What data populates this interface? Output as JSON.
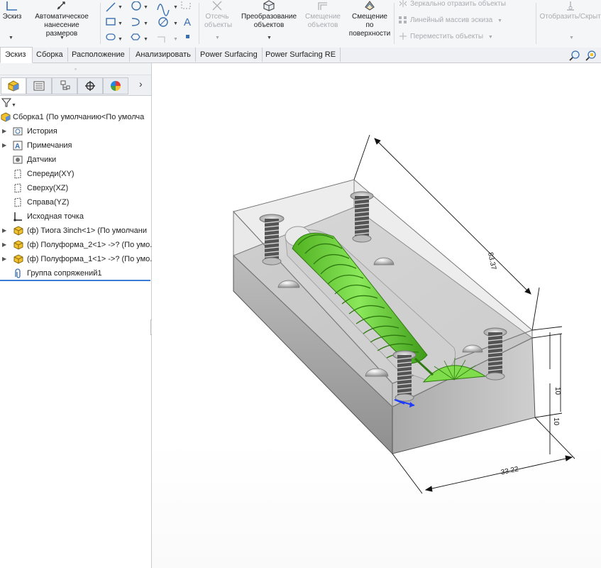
{
  "toolbar": {
    "sketch_label": "Эскиз",
    "smart_dim_label": "Автоматическое нанесение размеров",
    "trim_label": "Отсечь объекты",
    "convert_label": "Преобразование объектов",
    "offset_label": "Смещение объектов",
    "offset_surface_label": "Смещение по поверхности",
    "mirror_label": "Зеркально отразить объекты",
    "linear_pattern_label": "Линейный массив эскиза",
    "move_label": "Переместить объекты",
    "display_relations_label": "Отобразить/Скрыть взаимосвязи"
  },
  "tabs": [
    "Эскиз",
    "Сборка",
    "Расположение",
    "Анализировать",
    "Power Surfacing",
    "Power Surfacing RE"
  ],
  "tree": {
    "root": "Сборка1  (По умолчанию<По умолча",
    "items": [
      "История",
      "Примечания",
      "Датчики",
      "Спереди(XY)",
      "Сверху(XZ)",
      "Справа(YZ)",
      "Исходная точка",
      "(ф) Тиога 3inch<1> (По умолчани",
      "(ф) Полуформа_2<1> ->? (По умо...",
      "(ф) Полуформа_1<1> ->? (По умо...",
      "Группа сопряжений1"
    ]
  },
  "model": {
    "dim_length": "83.37",
    "dim_width": "33.22",
    "dim_upper": "10",
    "dim_lower": "10"
  },
  "colors": {
    "ribbon_bg": "#f5f6f8",
    "accent": "#3a7bd5",
    "lure_green": "#6fd23a",
    "mold_gray": "#9a9a9a"
  }
}
